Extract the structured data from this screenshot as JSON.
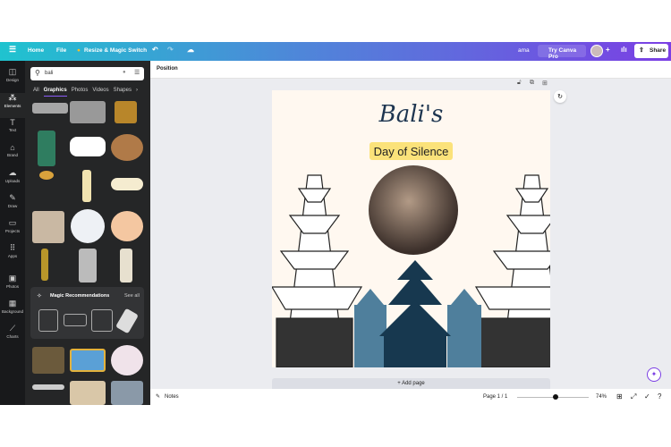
{
  "topbar": {
    "home": "Home",
    "file": "File",
    "resize": "Resize & Magic Switch",
    "user": "ama",
    "try_pro": "Try Canva Pro",
    "share": "Share"
  },
  "rail": [
    {
      "label": "Design",
      "icon": "layout-icon"
    },
    {
      "label": "Elements",
      "icon": "shapes-icon"
    },
    {
      "label": "Text",
      "icon": "text-icon"
    },
    {
      "label": "Brand",
      "icon": "brand-icon"
    },
    {
      "label": "Uploads",
      "icon": "upload-icon"
    },
    {
      "label": "Draw",
      "icon": "draw-icon"
    },
    {
      "label": "Projects",
      "icon": "folder-icon"
    },
    {
      "label": "Apps",
      "icon": "apps-icon"
    },
    {
      "label": "Photos",
      "icon": "photo-icon"
    },
    {
      "label": "Background",
      "icon": "background-icon"
    },
    {
      "label": "Charts",
      "icon": "chart-icon"
    }
  ],
  "panel": {
    "search_value": "bali",
    "tabs": [
      "All",
      "Graphics",
      "Photos",
      "Videos",
      "Shapes"
    ],
    "active_tab": "Graphics",
    "magic_title": "Magic Recommendations",
    "see_all": "See all"
  },
  "toolbar": {
    "position": "Position"
  },
  "design": {
    "title_script": "Bali's",
    "subtitle": "Day of Silence",
    "accent": "#fbe27a",
    "dark_pagoda": "#17384f",
    "light_pagoda": "#4f7f9c"
  },
  "canvas": {
    "add_page": "+ Add page"
  },
  "bottombar": {
    "notes": "Notes",
    "page": "Page 1 / 1",
    "zoom": "74%",
    "zoom_fraction": 0.5
  }
}
